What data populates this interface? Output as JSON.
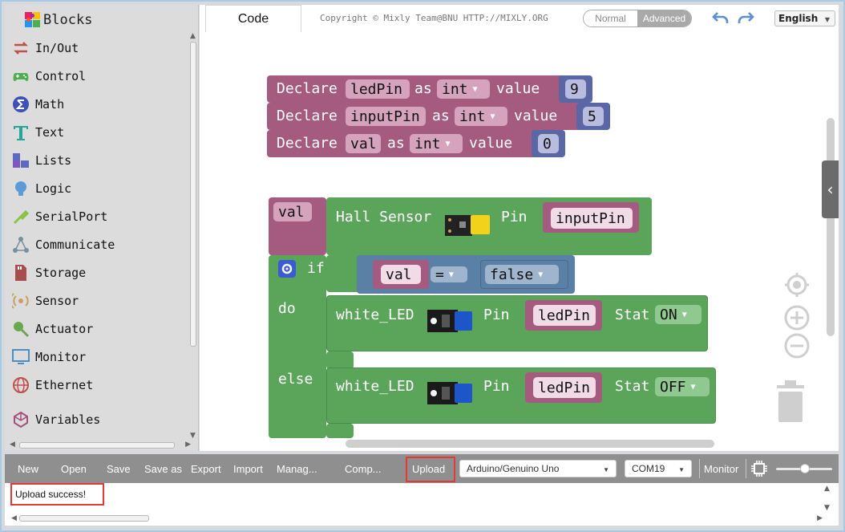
{
  "sidebar": {
    "title": "Blocks",
    "categories": [
      {
        "label": "In/Out",
        "icon": "arrows-icon",
        "color": "#c0504d"
      },
      {
        "label": "Control",
        "icon": "gamepad-icon",
        "color": "#4caf50"
      },
      {
        "label": "Math",
        "icon": "math-icon",
        "color": "#3f51b5"
      },
      {
        "label": "Text",
        "icon": "text-t-icon",
        "color": "#26a69a"
      },
      {
        "label": "Lists",
        "icon": "lists-icon",
        "color": "#5c6bc0"
      },
      {
        "label": "Logic",
        "icon": "bulb-icon",
        "color": "#5c9bd6"
      },
      {
        "label": "SerialPort",
        "icon": "usb-icon",
        "color": "#8bc34a"
      },
      {
        "label": "Communicate",
        "icon": "network-icon",
        "color": "#78909c"
      },
      {
        "label": "Storage",
        "icon": "sd-card-icon",
        "color": "#a84d4d"
      },
      {
        "label": "Sensor",
        "icon": "sensor-icon",
        "color": "#c8a060"
      },
      {
        "label": "Actuator",
        "icon": "actuator-icon",
        "color": "#6aa84f"
      },
      {
        "label": "Monitor",
        "icon": "monitor-icon",
        "color": "#4a8fc0"
      },
      {
        "label": "Ethernet",
        "icon": "globe-icon",
        "color": "#c0504d"
      },
      {
        "label": "Variables",
        "icon": "unity-icon",
        "color": "#a64d79"
      }
    ]
  },
  "topbar": {
    "tab_code": "Code",
    "copyright": "Copyright © Mixly Team@BNU HTTP://MIXLY.ORG",
    "mode_normal": "Normal",
    "mode_advanced": "Advanced",
    "language": "English"
  },
  "blocks": {
    "declare_word": "Declare",
    "as_word": "as",
    "value_word": "value",
    "declarations": [
      {
        "name": "ledPin",
        "type": "int",
        "value": "9"
      },
      {
        "name": "inputPin",
        "type": "int",
        "value": "5"
      },
      {
        "name": "val",
        "type": "int",
        "value": "0"
      }
    ],
    "assign_var": "val",
    "hall_sensor": "Hall Sensor",
    "pin_word": "Pin",
    "hall_pin": "inputPin",
    "if_word": "if",
    "do_word": "do",
    "else_word": "else",
    "cond_var": "val",
    "cond_op": "=",
    "cond_value": "false",
    "led_label": "white_LED",
    "stat_word": "Stat",
    "do_pin": "ledPin",
    "do_stat": "ON",
    "else_pin": "ledPin",
    "else_stat": "OFF"
  },
  "toolbar": {
    "new": "New",
    "open": "Open",
    "save": "Save",
    "save_as": "Save as",
    "export": "Export",
    "import": "Import",
    "manage": "Manag...",
    "compile": "Comp...",
    "upload": "Upload",
    "board": "Arduino/Genuino Uno",
    "port": "COM19",
    "monitor": "Monitor"
  },
  "output": {
    "message": "Upload success!"
  },
  "colors": {
    "declare": "#a55b80",
    "declare_value": "#5b67a5",
    "field_bg": "#d6a3bf",
    "control": "#5ba55b",
    "logic": "#5b80a5",
    "highlight": "#e53935"
  }
}
